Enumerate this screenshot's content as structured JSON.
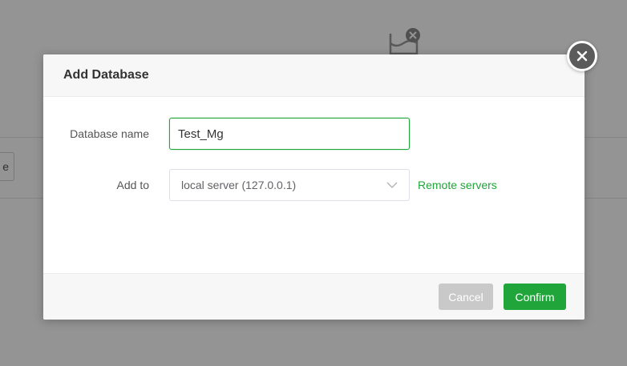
{
  "background": {
    "partial_button_label": "e"
  },
  "dialog": {
    "title": "Add Database",
    "fields": {
      "database_name": {
        "label": "Database name",
        "value": "Test_Mg"
      },
      "add_to": {
        "label": "Add to",
        "selected": "local server (127.0.0.1)",
        "link": "Remote servers"
      }
    },
    "buttons": {
      "cancel": "Cancel",
      "confirm": "Confirm"
    }
  },
  "colors": {
    "accent": "#20a53a",
    "cancel_bg": "#c9c9c9",
    "close_bg": "#5b5b5b"
  },
  "icons": {
    "close": "close-icon",
    "chevron": "chevron-down-icon",
    "empty_state": "empty-box-icon"
  }
}
